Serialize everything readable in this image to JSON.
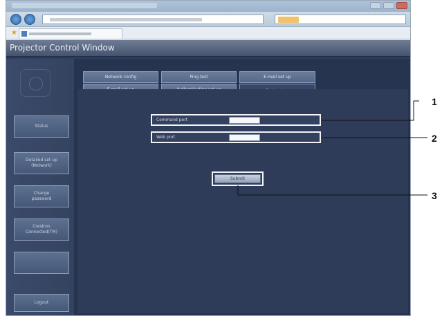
{
  "window": {
    "app_title": "Projector Control Window"
  },
  "sidebar": {
    "items": [
      {
        "id": "status",
        "label": "Status"
      },
      {
        "id": "detailed-set-up",
        "label": "Detailed set up\n(Network)"
      },
      {
        "id": "change-password",
        "label": "Change\npassword"
      },
      {
        "id": "crestron",
        "label": "Crestron\nConnected(TM)"
      },
      {
        "id": "other",
        "label": ""
      },
      {
        "id": "logout",
        "label": "Logout"
      }
    ]
  },
  "tabs": {
    "row1": [
      "Network config",
      "Ping test",
      "E-mail set up"
    ],
    "row2": [
      "E-mail set up",
      "Authentication set up",
      "Port set up"
    ]
  },
  "form": {
    "rows": [
      {
        "label": "Command port",
        "value": "",
        "default": ""
      },
      {
        "label": "Web port",
        "value": "",
        "default": ""
      }
    ],
    "submit_label": "Submit"
  },
  "callouts": [
    "1",
    "2",
    "3"
  ]
}
